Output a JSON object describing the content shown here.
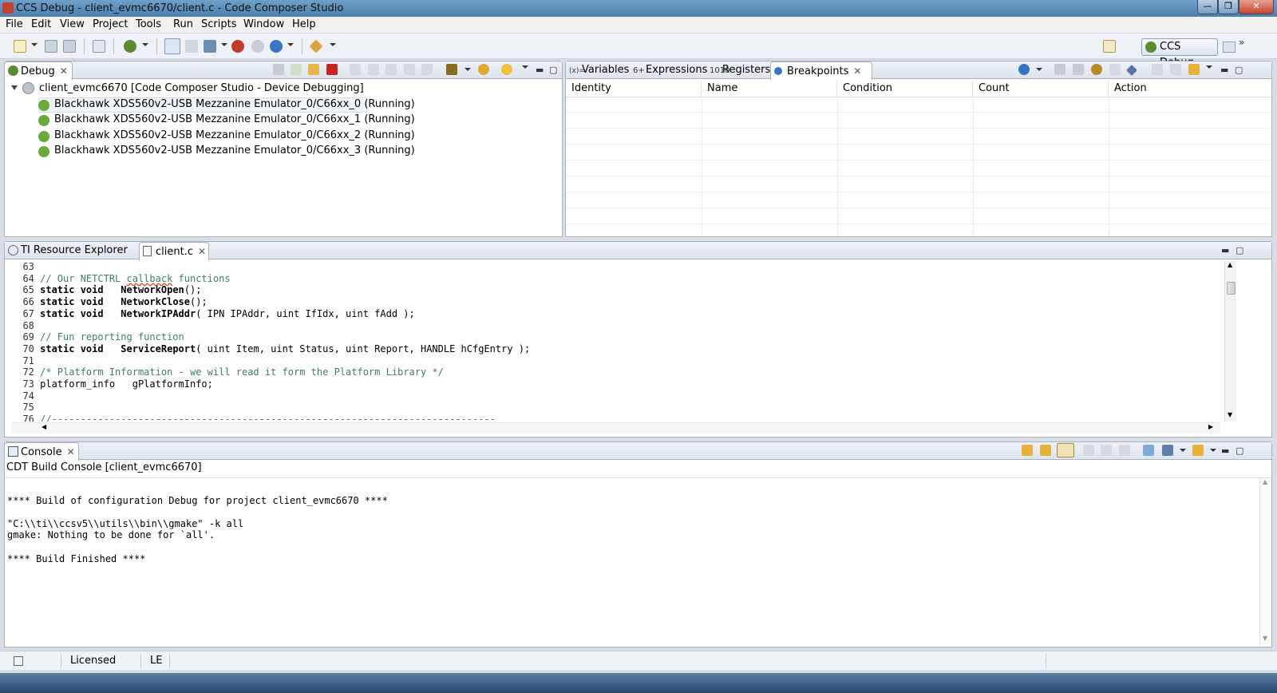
{
  "window": {
    "title": "CCS Debug - client_evmc6670/client.c - Code Composer Studio",
    "minimize": "—",
    "maximize": "❐",
    "close": "✕"
  },
  "menu": [
    "File",
    "Edit",
    "View",
    "Project",
    "Tools",
    "Run",
    "Scripts",
    "Window",
    "Help"
  ],
  "perspective": {
    "label": "CCS Debug",
    "more": "»"
  },
  "debug_view": {
    "tab_label": "Debug",
    "root": "client_evmc6670 [Code Composer Studio - Device Debugging]",
    "cores": [
      "Blackhawk XDS560v2-USB Mezzanine Emulator_0/C66xx_0 (Running)",
      "Blackhawk XDS560v2-USB Mezzanine Emulator_0/C66xx_1 (Running)",
      "Blackhawk XDS560v2-USB Mezzanine Emulator_0/C66xx_2 (Running)",
      "Blackhawk XDS560v2-USB Mezzanine Emulator_0/C66xx_3 (Running)"
    ]
  },
  "right_view": {
    "tabs": [
      "Variables",
      "Expressions",
      "Registers",
      "Breakpoints"
    ],
    "active_tab": "Breakpoints",
    "columns": [
      "Identity",
      "Name",
      "Condition",
      "Count",
      "Action"
    ]
  },
  "editor": {
    "tabs": [
      "TI Resource Explorer",
      "client.c"
    ],
    "active_tab": "client.c",
    "lines": [
      {
        "n": "63",
        "segs": []
      },
      {
        "n": "64",
        "segs": [
          {
            "t": "// Our NETCTRL ",
            "c": "cm"
          },
          {
            "t": "callback",
            "c": "cm sq"
          },
          {
            "t": " functions",
            "c": "cm"
          }
        ]
      },
      {
        "n": "65",
        "segs": [
          {
            "t": "static void",
            "c": "kw"
          },
          {
            "t": "   ",
            "c": ""
          },
          {
            "t": "NetworkOpen",
            "c": "fn"
          },
          {
            "t": "();",
            "c": ""
          }
        ]
      },
      {
        "n": "66",
        "segs": [
          {
            "t": "static void",
            "c": "kw"
          },
          {
            "t": "   ",
            "c": ""
          },
          {
            "t": "NetworkClose",
            "c": "fn"
          },
          {
            "t": "();",
            "c": ""
          }
        ]
      },
      {
        "n": "67",
        "segs": [
          {
            "t": "static void",
            "c": "kw"
          },
          {
            "t": "   ",
            "c": ""
          },
          {
            "t": "NetworkIPAddr",
            "c": "fn"
          },
          {
            "t": "( IPN IPAddr, uint IfIdx, uint fAdd );",
            "c": ""
          }
        ]
      },
      {
        "n": "68",
        "segs": []
      },
      {
        "n": "69",
        "segs": [
          {
            "t": "// Fun reporting function",
            "c": "cm"
          }
        ]
      },
      {
        "n": "70",
        "segs": [
          {
            "t": "static void",
            "c": "kw"
          },
          {
            "t": "   ",
            "c": ""
          },
          {
            "t": "ServiceReport",
            "c": "fn"
          },
          {
            "t": "( uint Item, uint Status, uint Report, HANDLE hCfgEntry );",
            "c": ""
          }
        ]
      },
      {
        "n": "71",
        "segs": []
      },
      {
        "n": "72",
        "segs": [
          {
            "t": "/* Platform Information - we will read it form the Platform Library */",
            "c": "cm"
          }
        ]
      },
      {
        "n": "73",
        "segs": [
          {
            "t": "platform_info   gPlatformInfo;",
            "c": ""
          }
        ]
      },
      {
        "n": "74",
        "segs": []
      },
      {
        "n": "75",
        "segs": []
      },
      {
        "n": "76",
        "segs": [
          {
            "t": "//-----------------------------------------------------------------------------",
            "c": "cm"
          }
        ]
      }
    ]
  },
  "console": {
    "tab_label": "Console",
    "header": "CDT Build Console [client_evmc6670]",
    "lines": [
      "",
      "**** Build of configuration Debug for project client_evmc6670 ****",
      "",
      "\"C:\\\\ti\\\\ccsv5\\\\utils\\\\bin\\\\gmake\" -k all",
      "gmake: Nothing to be done for `all'.",
      "",
      "**** Build Finished ****"
    ]
  },
  "status": {
    "license": "Licensed",
    "endian": "LE"
  },
  "colors": {
    "accent": "#4d7fae",
    "comment": "#3f7f5f",
    "stop": "#cc2222"
  },
  "icons": {
    "new": "new-file-icon",
    "save": "save-icon",
    "debug": "debug-bug-icon",
    "terminate": "terminate-icon",
    "resume": "resume-icon",
    "suspend": "suspend-icon"
  }
}
